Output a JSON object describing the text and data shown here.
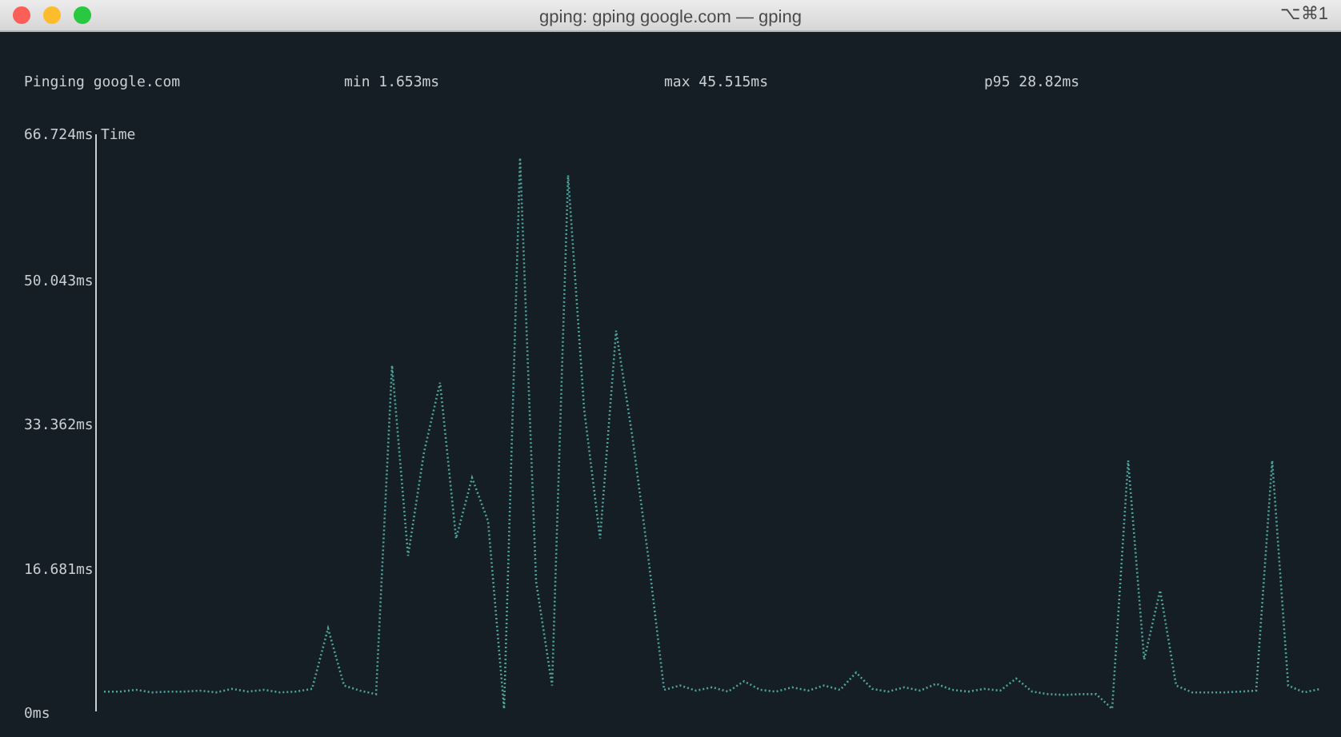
{
  "window": {
    "title": "gping: gping google.com — gping",
    "shortcut": "⌥⌘1"
  },
  "header": {
    "host": "Pinging google.com",
    "min": "min 1.653ms",
    "max": "max 45.515ms",
    "p95": "p95 28.82ms"
  },
  "chart": {
    "top_label": "66.724ms",
    "series_label": "Time",
    "chart_data": {
      "type": "line",
      "ylim": [
        0,
        66.724
      ],
      "yticks": [
        {
          "value": 0,
          "label": "0ms"
        },
        {
          "value": 16.681,
          "label": "16.681ms"
        },
        {
          "value": 33.362,
          "label": "33.362ms"
        },
        {
          "value": 50.043,
          "label": "50.043ms"
        }
      ],
      "series": [
        {
          "color": "#4fa39a",
          "line_style": "dotted",
          "values": [
            2.3,
            2.3,
            2.5,
            2.2,
            2.3,
            2.3,
            2.4,
            2.2,
            2.6,
            2.3,
            2.5,
            2.2,
            2.3,
            2.6,
            9.6,
            3.0,
            2.4,
            2.0,
            40,
            18,
            30,
            38,
            20,
            27,
            22,
            0.3,
            64,
            15,
            3,
            62,
            35,
            20,
            44,
            32,
            18,
            2.5,
            3,
            2.4,
            2.8,
            2.3,
            3.5,
            2.5,
            2.3,
            2.8,
            2.4,
            3.0,
            2.5,
            4.5,
            2.6,
            2.3,
            2.8,
            2.4,
            3.2,
            2.5,
            2.3,
            2.6,
            2.4,
            3.8,
            2.3,
            2.0,
            1.9,
            2.0,
            2.0,
            0.3,
            29,
            6,
            14,
            3,
            2.2,
            2.2,
            2.2,
            2.3,
            2.4,
            29,
            3,
            2.2,
            2.6
          ]
        }
      ]
    }
  }
}
